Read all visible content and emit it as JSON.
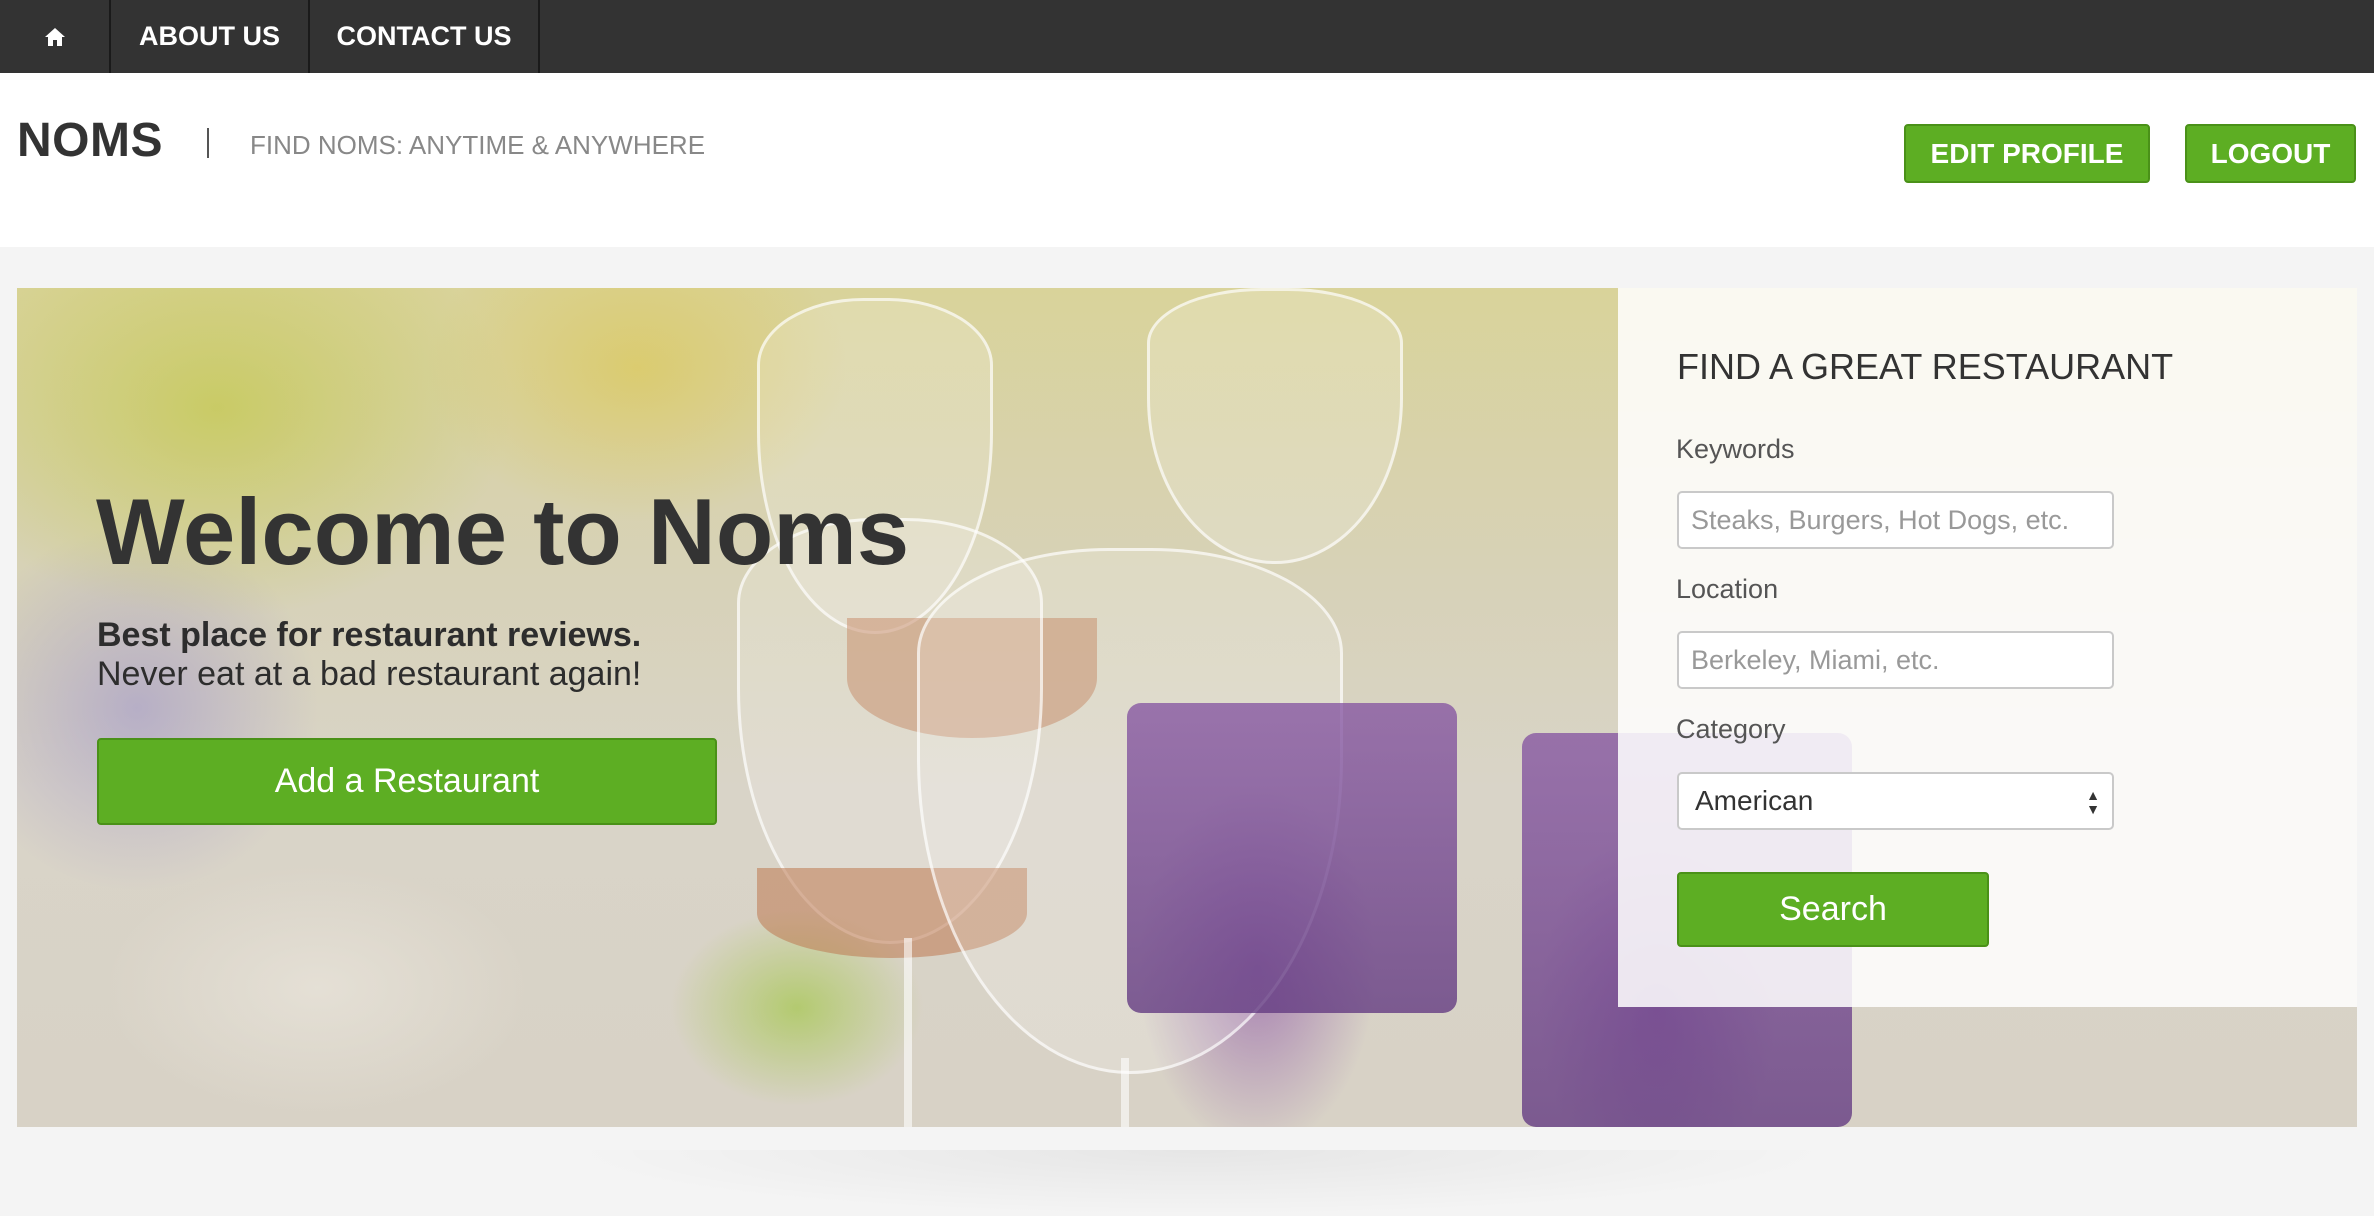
{
  "nav": {
    "home_icon": "home-icon",
    "about_label": "ABOUT US",
    "contact_label": "CONTACT US"
  },
  "header": {
    "brand": "NOMS",
    "tagline": "FIND NOMS: ANYTIME & ANYWHERE",
    "edit_profile_label": "EDIT PROFILE",
    "logout_label": "LOGOUT"
  },
  "hero": {
    "title": "Welcome to Noms",
    "subtitle_bold": "Best place for restaurant reviews.",
    "subtitle": "Never eat at a bad restaurant again!",
    "add_button_label": "Add a Restaurant"
  },
  "search": {
    "title": "FIND A GREAT RESTAURANT",
    "keywords_label": "Keywords",
    "keywords_placeholder": "Steaks, Burgers, Hot Dogs, etc.",
    "location_label": "Location",
    "location_placeholder": "Berkeley, Miami, etc.",
    "category_label": "Category",
    "category_selected": "American",
    "search_button_label": "Search"
  },
  "colors": {
    "nav_bg": "#333333",
    "accent_green": "#5dae23",
    "page_bg": "#f4f4f4"
  }
}
